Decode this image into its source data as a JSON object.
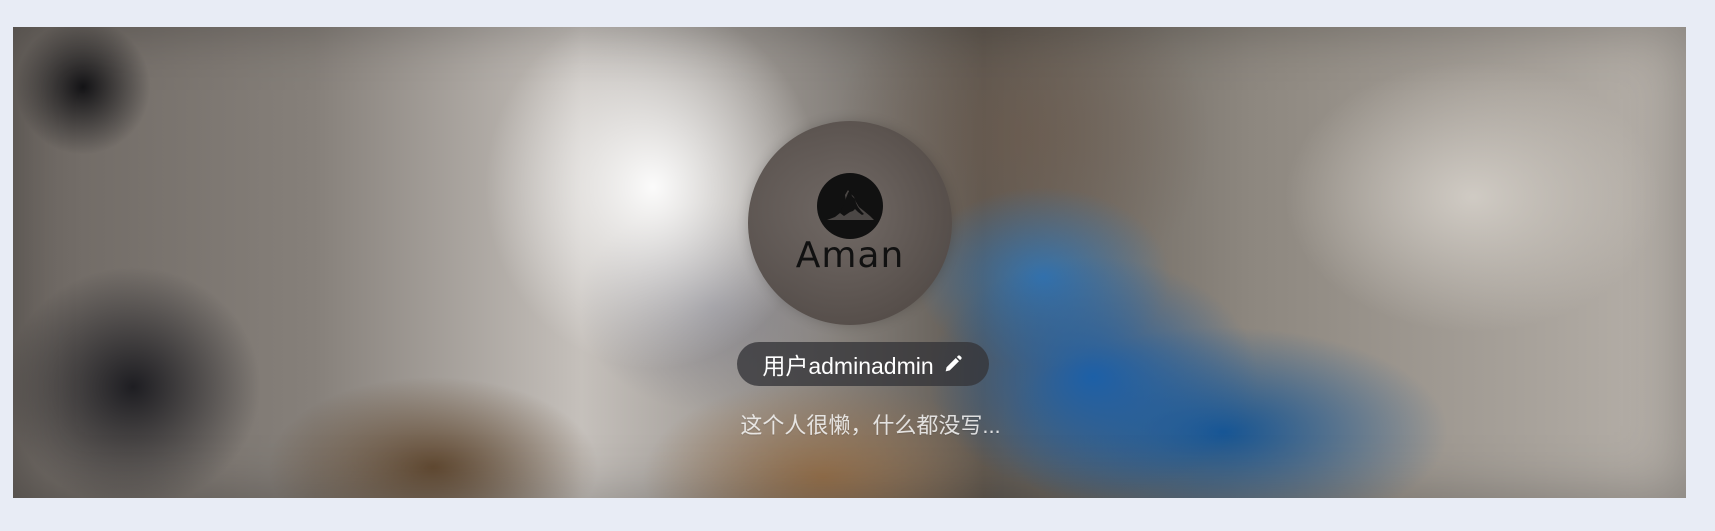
{
  "profile": {
    "logo_text": "Aman",
    "username": "用户adminadmin",
    "bio": "这个人很懒，什么都没写..."
  },
  "icons": {
    "logo": "wolf-icon",
    "edit": "pencil-icon"
  }
}
